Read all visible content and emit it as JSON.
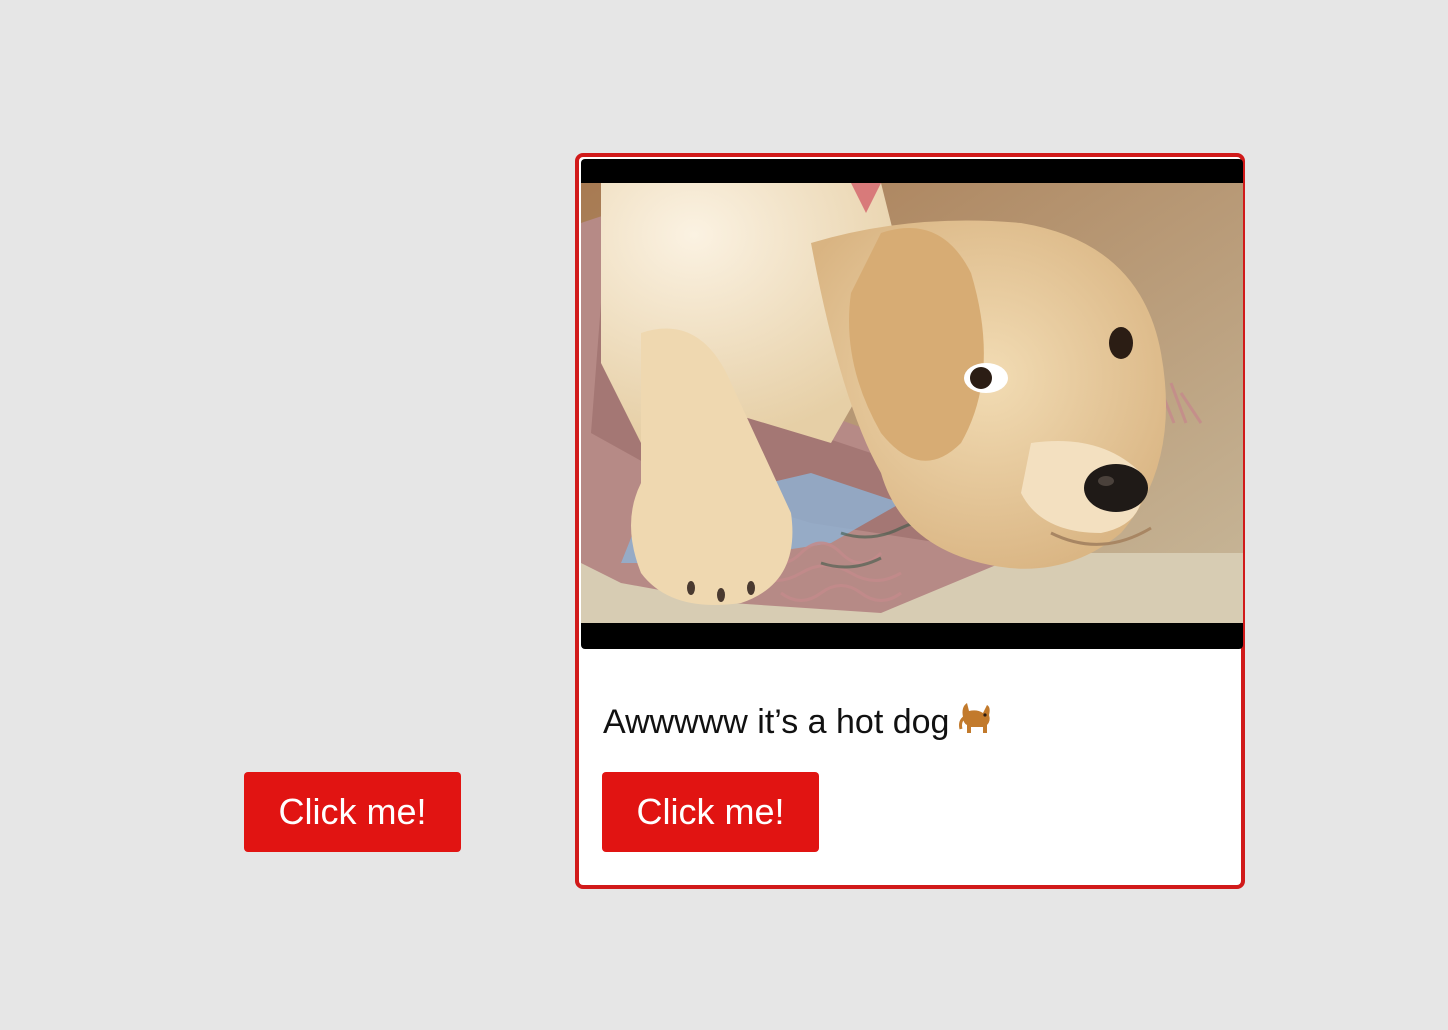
{
  "left_button": {
    "label": "Click me!"
  },
  "card": {
    "caption": "Awwwww it’s a hot dog",
    "caption_emoji_icon": "dog-icon",
    "button": {
      "label": "Click me!"
    },
    "photo_icon": "puppy-photo"
  },
  "colors": {
    "background": "#e6e6e6",
    "button": "#e11412",
    "card_border": "#d11a1a",
    "media_letterbox": "#000000"
  }
}
